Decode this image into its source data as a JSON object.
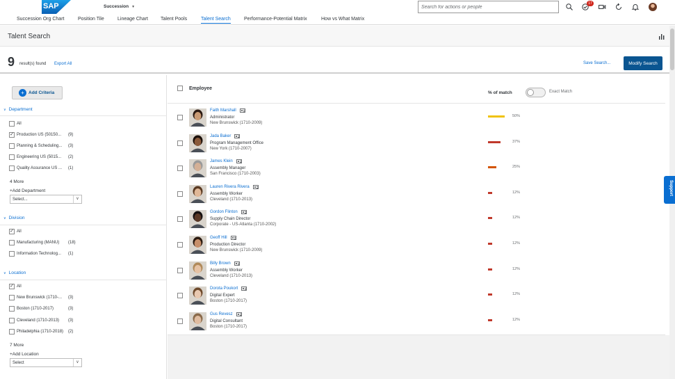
{
  "shell": {
    "logo_text": "SAP",
    "module": "Succession",
    "nav_tabs": [
      {
        "label": "Succession Org Chart"
      },
      {
        "label": "Position Tile"
      },
      {
        "label": "Lineage Chart"
      },
      {
        "label": "Talent Pools"
      },
      {
        "label": "Talent Search",
        "active": true
      },
      {
        "label": "Performance-Potential Matrix"
      },
      {
        "label": "How vs What Matrix"
      }
    ],
    "search_placeholder": "Search for actions or people",
    "notification_count": "17",
    "icons": [
      "search-icon",
      "notification-check-icon",
      "video-icon",
      "refresh-icon",
      "bell-icon",
      "user-avatar"
    ]
  },
  "page": {
    "title": "Talent Search",
    "result_count": "9",
    "result_label": "result(s) found",
    "export_all": "Export All",
    "save_search": "Save Search...",
    "modify_search": "Modify Search"
  },
  "filters": {
    "add_criteria": "Add Criteria",
    "department": {
      "heading": "Department",
      "options": [
        {
          "label": "All",
          "count": "",
          "checked": false
        },
        {
          "label": "Production US (50150...",
          "count": "(9)",
          "checked": true
        },
        {
          "label": "Planning & Scheduling...",
          "count": "(3)",
          "checked": false
        },
        {
          "label": "Engineering US (5015...",
          "count": "(2)",
          "checked": false
        },
        {
          "label": "Quality Assurance US ...",
          "count": "(1)",
          "checked": false
        }
      ],
      "more": "4 More",
      "add": "+Add Department",
      "select": "Select..."
    },
    "division": {
      "heading": "Division",
      "options": [
        {
          "label": "All",
          "count": "",
          "checked": true
        },
        {
          "label": "Manufacturing (MANU)",
          "count": "(18)",
          "checked": false
        },
        {
          "label": "Information Technolog...",
          "count": "(1)",
          "checked": false
        }
      ]
    },
    "location": {
      "heading": "Location",
      "options": [
        {
          "label": "All",
          "count": "",
          "checked": true
        },
        {
          "label": "New Brunswick (1710-...",
          "count": "(3)",
          "checked": false
        },
        {
          "label": "Boston (1710-2017)",
          "count": "(3)",
          "checked": false
        },
        {
          "label": "Cleveland (1710-2013)",
          "count": "(3)",
          "checked": false
        },
        {
          "label": "Philadelphia (1710-2018)",
          "count": "(2)",
          "checked": false
        }
      ],
      "more": "7 More",
      "add": "+Add Location",
      "select": "Select"
    }
  },
  "results": {
    "col_employee": "Employee",
    "col_match": "% of match",
    "exact_match": "Exact Match",
    "exact_match_on": false,
    "employees": [
      {
        "name": "Faith Marshall",
        "title": "Administrator",
        "location": "New Brunswick (1710-2009)",
        "match": 50,
        "match_label": "50%",
        "color": "#f0c20a",
        "skin": "#c99a74",
        "hair": "#2b1a12"
      },
      {
        "name": "Jada Baker",
        "title": "Program Management Office",
        "location": "New York (1710-2007)",
        "match": 37,
        "match_label": "37%",
        "color": "#c0392b",
        "skin": "#8a5a3b",
        "hair": "#1a0f0a"
      },
      {
        "name": "James Klein",
        "title": "Assembly Manager",
        "location": "San Francisco (1710-2003)",
        "match": 25,
        "match_label": "25%",
        "color": "#d35400",
        "skin": "#d4b096",
        "hair": "#9a9a9a"
      },
      {
        "name": "Lauren Rivera Rivera",
        "title": "Assembly Worker",
        "location": "Cleveland (1710-2013)",
        "match": 12,
        "match_label": "12%",
        "color": "#c0392b",
        "skin": "#e0b898",
        "hair": "#5a3a22"
      },
      {
        "name": "Gordon Flinton",
        "title": "Supply Chain Director",
        "location": "Corporate - US-Atlanta (1710-2002)",
        "match": 12,
        "match_label": "12%",
        "color": "#c0392b",
        "skin": "#5a3826",
        "hair": "#151010"
      },
      {
        "name": "Geoff Hill",
        "title": "Production Director",
        "location": "New Brunswick (1710-2009)",
        "match": 12,
        "match_label": "12%",
        "color": "#c0392b",
        "skin": "#c78f6a",
        "hair": "#2a1a10"
      },
      {
        "name": "Billy Brown",
        "title": "Assembly Worker",
        "location": "Cleveland (1710-2013)",
        "match": 12,
        "match_label": "12%",
        "color": "#c0392b",
        "skin": "#e6c2a4",
        "hair": "#b08a5a"
      },
      {
        "name": "Dorota Poukort",
        "title": "Digital Expert",
        "location": "Boston (1710-2017)",
        "match": 12,
        "match_label": "12%",
        "color": "#c0392b",
        "skin": "#e8c8b0",
        "hair": "#6e4a2c"
      },
      {
        "name": "Gus Revesz",
        "title": "Digital Consultant",
        "location": "Boston (1710-2017)",
        "match": 12,
        "match_label": "12%",
        "color": "#c0392b",
        "skin": "#e0bca0",
        "hair": "#8a6a4a"
      }
    ]
  },
  "support": "Support",
  "colors": {
    "accent": "#0a6ed1",
    "primary_button": "#0a5591",
    "badge": "#d0271d"
  }
}
